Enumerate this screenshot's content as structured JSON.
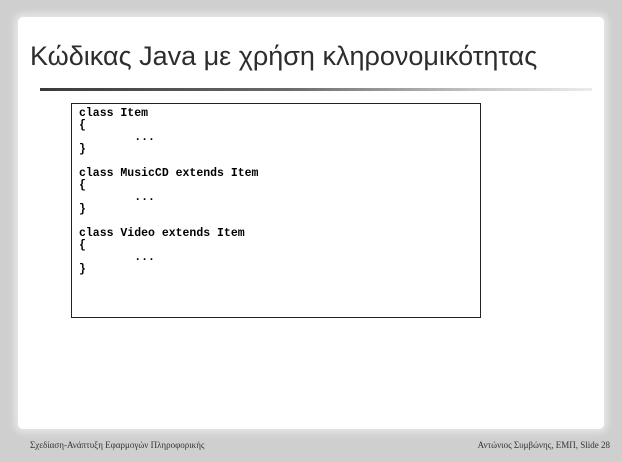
{
  "slide": {
    "title": "Κώδικας Java με χρήση κληρονομικότητας",
    "code": "class Item\n{\n        ...\n}\n\nclass MusicCD extends Item\n{\n        ...\n}\n\nclass Video extends Item\n{\n        ...\n}",
    "footer_left": "Σχεδίαση-Ανάπτυξη Εφαρμογών Πληροφορικής",
    "footer_right": "Αντώνιος Συμβώνης, ΕΜΠ, Slide 28"
  }
}
